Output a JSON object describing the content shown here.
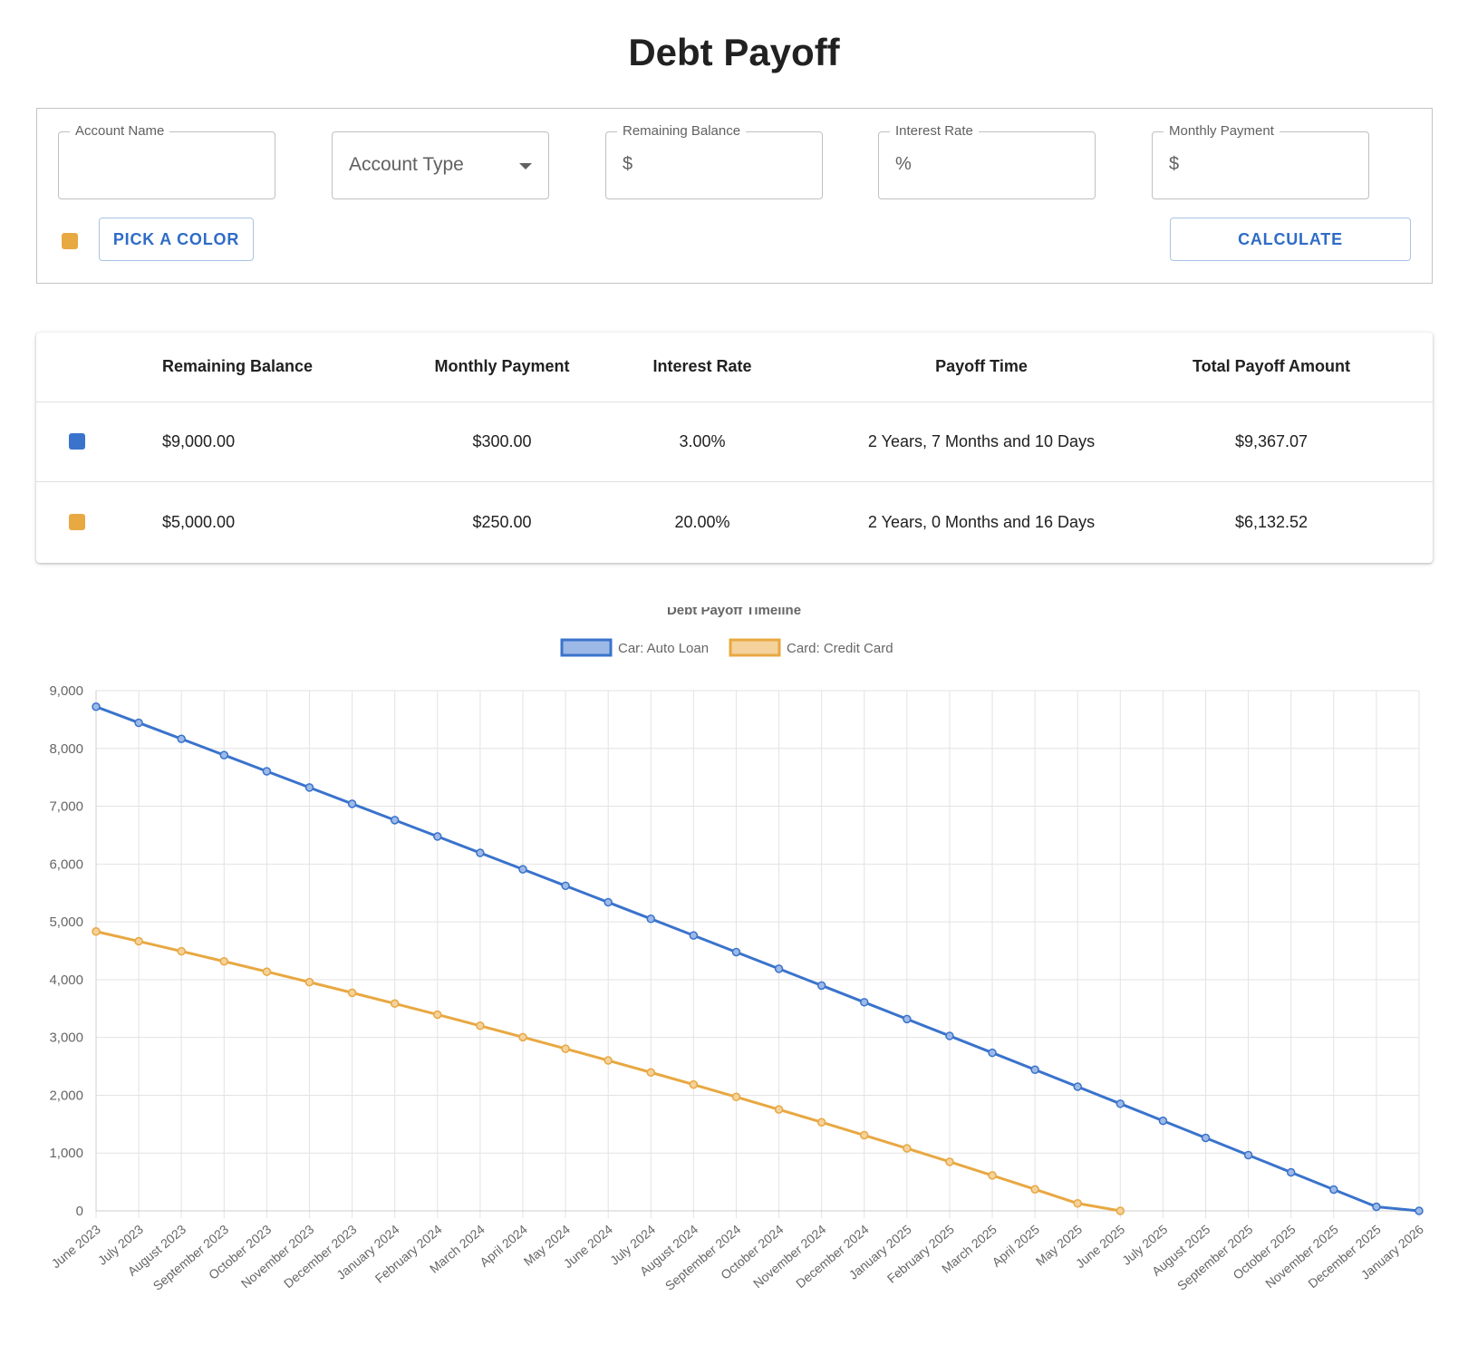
{
  "page": {
    "title": "Debt Payoff"
  },
  "form": {
    "account_name": {
      "label": "Account Name",
      "value": ""
    },
    "account_type": {
      "placeholder": "Account Type"
    },
    "remaining_balance": {
      "label": "Remaining Balance",
      "prefix": "$",
      "value": ""
    },
    "interest_rate": {
      "label": "Interest Rate",
      "prefix": "%",
      "value": ""
    },
    "monthly_payment": {
      "label": "Monthly Payment",
      "prefix": "$",
      "value": ""
    },
    "selected_color": "#e8a842",
    "pick_color_label": "PICK A COLOR",
    "calculate_label": "CALCULATE"
  },
  "table": {
    "headers": [
      "Remaining Balance",
      "Monthly Payment",
      "Interest Rate",
      "Payoff Time",
      "Total Payoff Amount"
    ],
    "rows": [
      {
        "color": "#3a73cc",
        "balance": "$9,000.00",
        "payment": "$300.00",
        "rate": "3.00%",
        "payoff_time": "2 Years, 7 Months and 10 Days",
        "total": "$9,367.07"
      },
      {
        "color": "#e8a842",
        "balance": "$5,000.00",
        "payment": "$250.00",
        "rate": "20.00%",
        "payoff_time": "2 Years, 0 Months and 16 Days",
        "total": "$6,132.52"
      }
    ]
  },
  "chart_data": {
    "type": "line",
    "title": "Debt Payoff Timeline",
    "xlabel": "",
    "ylabel": "",
    "ylim": [
      0,
      9000
    ],
    "yticks": [
      0,
      1000,
      2000,
      3000,
      4000,
      5000,
      6000,
      7000,
      8000,
      9000
    ],
    "ytick_labels": [
      "0",
      "1,000",
      "2,000",
      "3,000",
      "4,000",
      "5,000",
      "6,000",
      "7,000",
      "8,000",
      "9,000"
    ],
    "grid": true,
    "legend_position": "top-center",
    "categories": [
      "June 2023",
      "July 2023",
      "August 2023",
      "September 2023",
      "October 2023",
      "November 2023",
      "December 2023",
      "January 2024",
      "February 2024",
      "March 2024",
      "April 2024",
      "May 2024",
      "June 2024",
      "July 2024",
      "August 2024",
      "September 2024",
      "October 2024",
      "November 2024",
      "December 2024",
      "January 2025",
      "February 2025",
      "March 2025",
      "April 2025",
      "May 2025",
      "June 2025",
      "July 2025",
      "August 2025",
      "September 2025",
      "October 2025",
      "November 2025",
      "December 2025",
      "January 2026"
    ],
    "series": [
      {
        "name": "Car: Auto Loan",
        "color": "#3a73cc",
        "fill": "#9db9e6",
        "values": [
          8722,
          8444,
          8165,
          7885,
          7605,
          7324,
          7042,
          6760,
          6477,
          6193,
          5909,
          5624,
          5338,
          5052,
          4765,
          4477,
          4188,
          3899,
          3609,
          3318,
          3027,
          2735,
          2442,
          2148,
          1853,
          1558,
          1262,
          965,
          667,
          369,
          70,
          0
        ]
      },
      {
        "name": "Card: Credit Card",
        "color": "#e8a842",
        "fill": "#f5d29b",
        "values": [
          4833,
          4664,
          4491,
          4316,
          4138,
          3957,
          3773,
          3586,
          3395,
          3202,
          3005,
          2805,
          2602,
          2395,
          2185,
          1971,
          1754,
          1533,
          1309,
          1081,
          849,
          613,
          373,
          129,
          0
        ]
      }
    ]
  }
}
